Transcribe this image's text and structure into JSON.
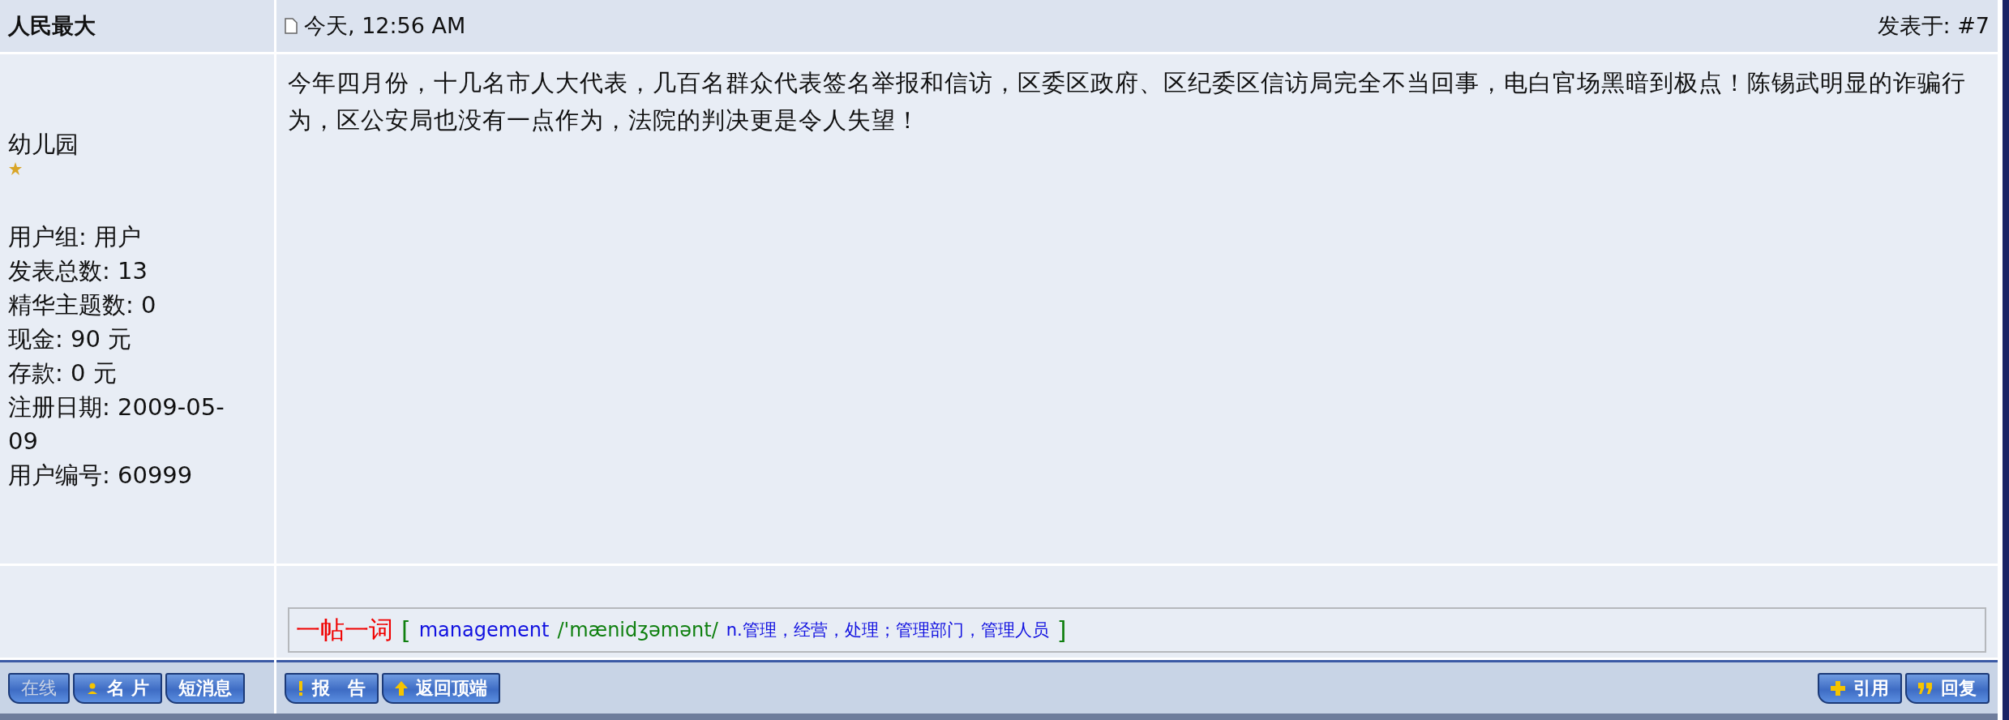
{
  "author": {
    "name": "人民最大",
    "rank_title": "幼儿园",
    "stats": [
      "用户组: 用户",
      "发表总数: 13",
      "精华主题数: 0",
      "现金: 90 元",
      "存款: 0 元",
      "注册日期: 2009-05-09",
      "用户编号: 60999"
    ]
  },
  "post": {
    "time": "今天, 12:56 AM",
    "post_number": "发表于: #7",
    "body": "今年四月份，十几名市人大代表，几百名群众代表签名举报和信访，区委区政府、区纪委区信访局完全不当回事，电白官场黑暗到极点！陈锡武明显的诈骗行为，区公安局也没有一点作为，法院的判决更是令人失望！"
  },
  "word_of_day": {
    "label": "一帖一词",
    "open_bracket": "[",
    "word": "management",
    "phonetic": "/'mænidʒəmənt/",
    "definition": "n.管理，经营，处理；管理部门，管理人员",
    "close_bracket": "]"
  },
  "author_buttons": [
    {
      "label": "在线",
      "disabled": true
    },
    {
      "label": "名 片",
      "disabled": false
    },
    {
      "label": "短消息",
      "disabled": false
    }
  ],
  "post_buttons": [
    {
      "label": "报　告"
    },
    {
      "label": "返回顶端"
    }
  ],
  "reply_buttons": [
    {
      "label": "引用"
    },
    {
      "label": "回复"
    }
  ]
}
